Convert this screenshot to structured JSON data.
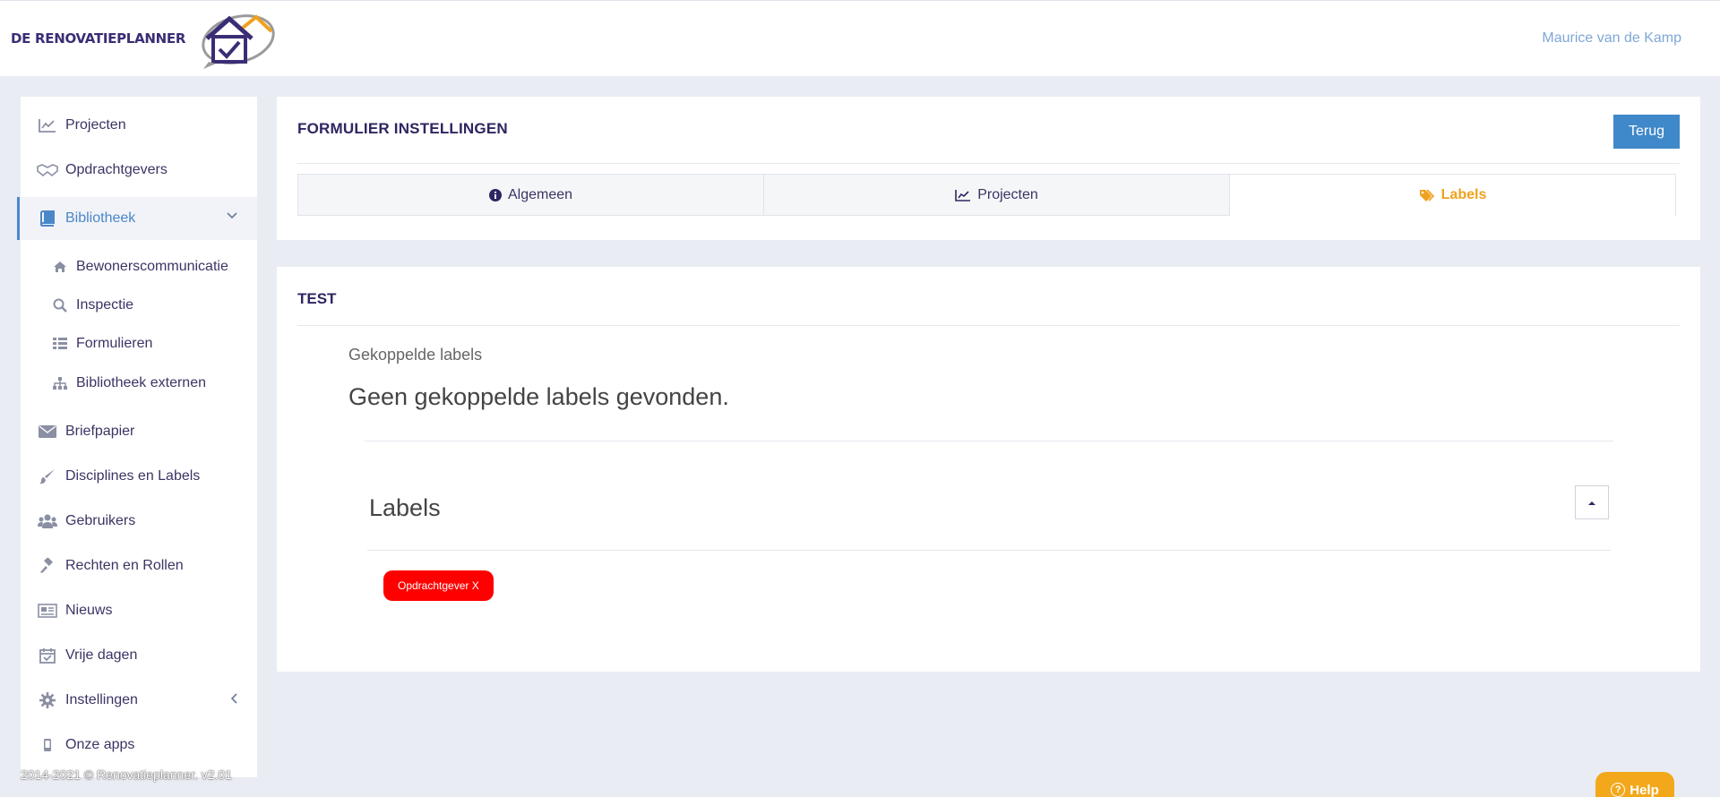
{
  "header": {
    "logo_text": "DE RENOVATIEPLANNER",
    "user_name": "Maurice van de Kamp"
  },
  "sidebar": {
    "items": [
      {
        "label": "Projecten",
        "icon": "chart-line-icon"
      },
      {
        "label": "Opdrachtgevers",
        "icon": "handshake-icon"
      },
      {
        "label": "Bibliotheek",
        "icon": "book-icon"
      },
      {
        "label": "Briefpapier",
        "icon": "envelope-icon"
      },
      {
        "label": "Disciplines en Labels",
        "icon": "brush-icon"
      },
      {
        "label": "Gebruikers",
        "icon": "users-icon"
      },
      {
        "label": "Rechten en Rollen",
        "icon": "gavel-icon"
      },
      {
        "label": "Nieuws",
        "icon": "newspaper-icon"
      },
      {
        "label": "Vrije dagen",
        "icon": "calendar-check-icon"
      },
      {
        "label": "Instellingen",
        "icon": "gear-icon"
      },
      {
        "label": "Onze apps",
        "icon": "mobile-icon"
      }
    ],
    "sub_items": [
      {
        "label": "Bewonerscommunicatie",
        "icon": "home-icon"
      },
      {
        "label": "Inspectie",
        "icon": "search-icon"
      },
      {
        "label": "Formulieren",
        "icon": "list-icon"
      },
      {
        "label": "Bibliotheek externen",
        "icon": "sitemap-icon"
      }
    ]
  },
  "footer": {
    "text": "2014-2021 © Renovatieplanner. v2.01"
  },
  "settings_panel": {
    "title": "FORMULIER INSTELLINGEN",
    "back_button": "Terug",
    "tabs": [
      {
        "label": "Algemeen",
        "icon": "info-circle-icon"
      },
      {
        "label": "Projecten",
        "icon": "chart-line-icon"
      },
      {
        "label": "Labels",
        "icon": "tags-icon"
      }
    ],
    "active_tab": "Labels"
  },
  "test_panel": {
    "title": "TEST",
    "linked_heading": "Gekoppelde labels",
    "empty_message": "Geen gekoppelde labels gevonden.",
    "labels_title": "Labels",
    "labels": [
      {
        "text": "Opdrachtgever X",
        "color": "#ff0000"
      }
    ]
  },
  "help": {
    "label": "Help"
  },
  "colors": {
    "accent": "#3f88c9",
    "active_tab": "#f0a11f",
    "brand": "#3b2d75"
  }
}
